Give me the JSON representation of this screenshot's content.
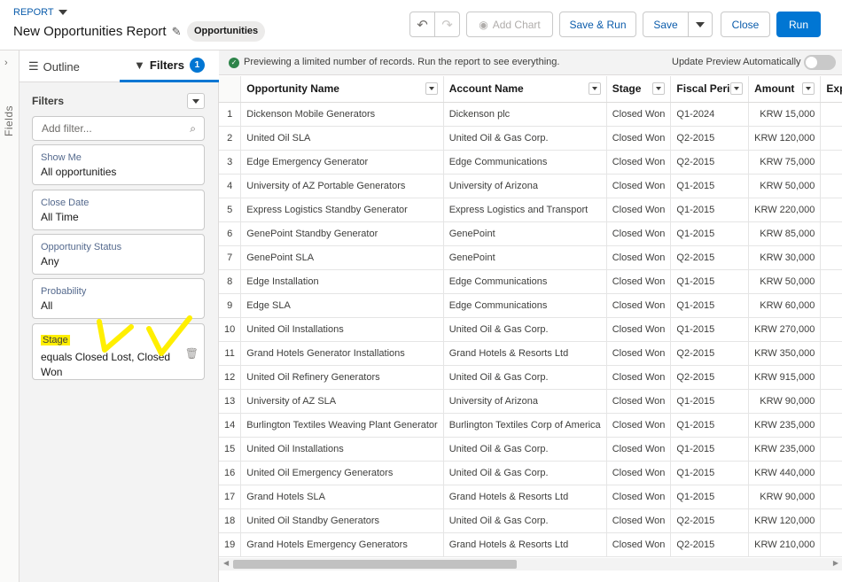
{
  "header": {
    "breadcrumb": "REPORT",
    "title": "New Opportunities Report",
    "report_type": "Opportunities",
    "buttons": {
      "add_chart": "Add Chart",
      "save_run": "Save & Run",
      "save": "Save",
      "close": "Close",
      "run": "Run"
    }
  },
  "left_rail": {
    "label": "Fields"
  },
  "panel": {
    "tabs": {
      "outline": "Outline",
      "filters": "Filters",
      "filters_count": "1"
    },
    "filters_heading": "Filters",
    "add_filter_placeholder": "Add filter...",
    "filters": [
      {
        "label": "Show Me",
        "value": "All opportunities"
      },
      {
        "label": "Close Date",
        "value": "All Time"
      },
      {
        "label": "Opportunity Status",
        "value": "Any"
      },
      {
        "label": "Probability",
        "value": "All"
      },
      {
        "label": "Stage",
        "value": "equals Closed Lost, Closed Won"
      }
    ]
  },
  "preview": {
    "message": "Previewing a limited number of records. Run the report to see everything.",
    "auto_label": "Update Preview Automatically",
    "auto_on": false
  },
  "table": {
    "columns": [
      "Opportunity Name",
      "Account Name",
      "Stage",
      "Fiscal Period",
      "Amount",
      "Expe"
    ],
    "rows": [
      [
        "1",
        "Dickenson Mobile Generators",
        "Dickenson plc",
        "Closed Won",
        "Q1-2024",
        "KRW 15,000"
      ],
      [
        "2",
        "United Oil SLA",
        "United Oil & Gas Corp.",
        "Closed Won",
        "Q2-2015",
        "KRW 120,000"
      ],
      [
        "3",
        "Edge Emergency Generator",
        "Edge Communications",
        "Closed Won",
        "Q2-2015",
        "KRW 75,000"
      ],
      [
        "4",
        "University of AZ Portable Generators",
        "University of Arizona",
        "Closed Won",
        "Q1-2015",
        "KRW 50,000"
      ],
      [
        "5",
        "Express Logistics Standby Generator",
        "Express Logistics and Transport",
        "Closed Won",
        "Q1-2015",
        "KRW 220,000"
      ],
      [
        "6",
        "GenePoint Standby Generator",
        "GenePoint",
        "Closed Won",
        "Q1-2015",
        "KRW 85,000"
      ],
      [
        "7",
        "GenePoint SLA",
        "GenePoint",
        "Closed Won",
        "Q2-2015",
        "KRW 30,000"
      ],
      [
        "8",
        "Edge Installation",
        "Edge Communications",
        "Closed Won",
        "Q1-2015",
        "KRW 50,000"
      ],
      [
        "9",
        "Edge SLA",
        "Edge Communications",
        "Closed Won",
        "Q1-2015",
        "KRW 60,000"
      ],
      [
        "10",
        "United Oil Installations",
        "United Oil & Gas Corp.",
        "Closed Won",
        "Q1-2015",
        "KRW 270,000"
      ],
      [
        "11",
        "Grand Hotels Generator Installations",
        "Grand Hotels & Resorts Ltd",
        "Closed Won",
        "Q2-2015",
        "KRW 350,000"
      ],
      [
        "12",
        "United Oil Refinery Generators",
        "United Oil & Gas Corp.",
        "Closed Won",
        "Q2-2015",
        "KRW 915,000"
      ],
      [
        "13",
        "University of AZ SLA",
        "University of Arizona",
        "Closed Won",
        "Q1-2015",
        "KRW 90,000"
      ],
      [
        "14",
        "Burlington Textiles Weaving Plant Generator",
        "Burlington Textiles Corp of America",
        "Closed Won",
        "Q1-2015",
        "KRW 235,000"
      ],
      [
        "15",
        "United Oil Installations",
        "United Oil & Gas Corp.",
        "Closed Won",
        "Q1-2015",
        "KRW 235,000"
      ],
      [
        "16",
        "United Oil Emergency Generators",
        "United Oil & Gas Corp.",
        "Closed Won",
        "Q1-2015",
        "KRW 440,000"
      ],
      [
        "17",
        "Grand Hotels SLA",
        "Grand Hotels & Resorts Ltd",
        "Closed Won",
        "Q1-2015",
        "KRW 90,000"
      ],
      [
        "18",
        "United Oil Standby Generators",
        "United Oil & Gas Corp.",
        "Closed Won",
        "Q2-2015",
        "KRW 120,000"
      ],
      [
        "19",
        "Grand Hotels Emergency Generators",
        "Grand Hotels & Resorts Ltd",
        "Closed Won",
        "Q2-2015",
        "KRW 210,000"
      ]
    ]
  },
  "colors": {
    "brand": "#0176d3",
    "highlight": "#ffef00",
    "success": "#2e844a"
  }
}
